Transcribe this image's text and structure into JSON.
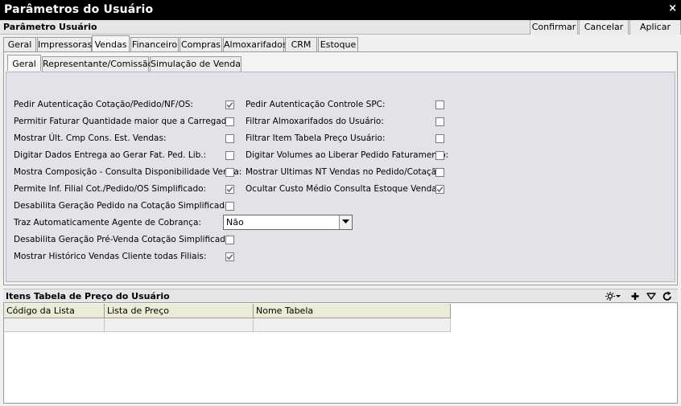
{
  "window": {
    "title": "Parâmetros do Usuário",
    "close_glyph": "×"
  },
  "header": {
    "label": "Parâmetro Usuário",
    "buttons": [
      "Confirmar",
      "Cancelar",
      "Aplicar"
    ]
  },
  "main_tabs": [
    "Geral",
    "Impressoras",
    "Vendas",
    "Financeiro",
    "Compras",
    "Almoxarifados",
    "CRM",
    "Estoque"
  ],
  "main_tabs_active": "Vendas",
  "sub_tabs": [
    "Geral",
    "Representante/Comissão",
    "Simulação de Venda"
  ],
  "sub_tabs_active": "Geral",
  "fields_left": [
    {
      "label": "Pedir Autenticação Cotação/Pedido/NF/OS:",
      "checked": true
    },
    {
      "label": "Permitir Faturar Quantidade maior que a Carregada:",
      "checked": false
    },
    {
      "label": "Mostrar Últ. Cmp Cons. Est. Vendas:",
      "checked": false
    },
    {
      "label": "Digitar Dados Entrega ao Gerar Fat. Ped. Lib.:",
      "checked": false
    },
    {
      "label": "Mostra Composição - Consulta Disponibilidade Venda:",
      "checked": false
    },
    {
      "label": "Permite Inf. Filial Cot./Pedido/OS Simplificado:",
      "checked": true
    },
    {
      "label": "Desabilita Geração Pedido na Cotação Simplificada:",
      "checked": false
    }
  ],
  "fields_right": [
    {
      "label": "Pedir Autenticação Controle SPC:",
      "checked": false
    },
    {
      "label": "Filtrar Almoxarifados do Usuário:",
      "checked": false
    },
    {
      "label": "Filtrar Item Tabela Preço Usuário:",
      "checked": false
    },
    {
      "label": "Digitar Volumes ao Liberar Pedido Faturamento:",
      "checked": false
    },
    {
      "label": "Mostrar Ultimas NT Vendas no Pedido/Cotação:",
      "checked": false
    },
    {
      "label": "Ocultar Custo Médio Consulta Estoque Vendas:",
      "checked": true
    }
  ],
  "agent_field": {
    "label": "Traz Automaticamente Agente de Cobrança:",
    "value": "Não"
  },
  "fields_bottom": [
    {
      "label": "Desabilita Geração Pré-Venda Cotação Simplificada:",
      "checked": false
    },
    {
      "label": "Mostrar Histórico Vendas Cliente todas Filiais:",
      "checked": true
    }
  ],
  "price_items": {
    "title": "Itens Tabela de Preço do Usuário",
    "toolbar": [
      "columns-icon",
      "chevron-down-icon",
      "plus-icon",
      "filter-icon",
      "refresh-icon"
    ],
    "columns": [
      "Código da Lista",
      "Lista de Preço",
      "Nome Tabela"
    ]
  },
  "colors": {
    "titlebar": "#000000",
    "panel": "#e2e2e8",
    "grid_header": "#ecebd8",
    "check": "#6b6b6b"
  }
}
